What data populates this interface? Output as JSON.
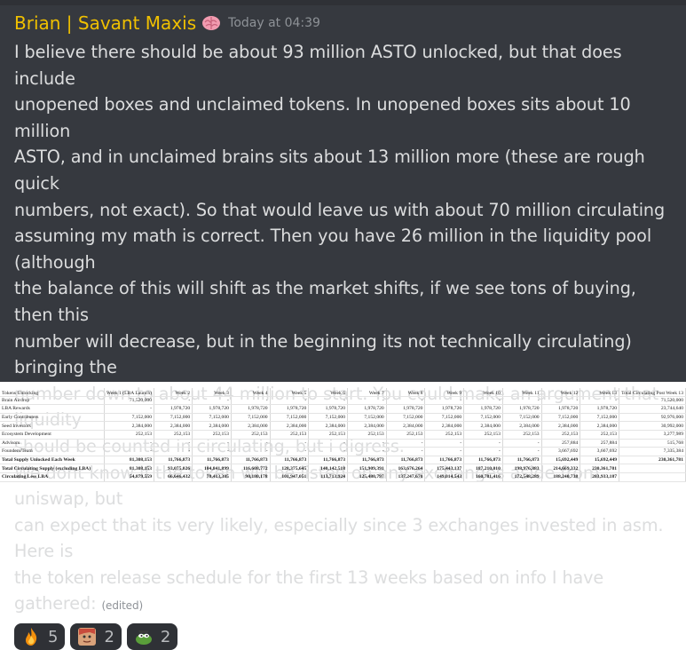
{
  "message": {
    "username": "Brian | Savant Maxis",
    "badge_icon": "brain-icon",
    "timestamp": "Today at 04:39",
    "lines": [
      "I believe there should be about 93 million ASTO unlocked, but that does include",
      "unopened boxes and unclaimed tokens. In unopened boxes sits about 10 million",
      "ASTO, and in unclaimed brains sits about 13 million more (these are rough quick",
      "numbers, not exact). So that would leave us with about 70 million circulating",
      "assuming my math is correct. Then you have 26 million in the liquidity pool (although",
      "the balance of this will shift as the market shifts, if we see tons of buying, then this",
      "number will decrease, but in the beginning its not technically circulating) bringing the",
      "number down to about 44 million to start. You could make an argument that liquidity",
      "should be counted in circulating, but i digress.",
      "We dont know if the token will be listed on any exchanges aside from uniswap, but",
      "can expect that its very likely, especially since 3 exchanges invested in asm. Here is",
      "the token release schedule for the first 13 weeks based on info I have gathered:"
    ],
    "edited_label": "(edited)"
  },
  "reactions": [
    {
      "icon": "fire-icon",
      "count": "5"
    },
    {
      "icon": "face-icon",
      "count": "2"
    },
    {
      "icon": "pepe-icon",
      "count": "2"
    }
  ],
  "spreadsheet": {
    "header": [
      "Tokens Unlocking",
      "Week 1 (LBA Launch)",
      "Week 2",
      "Week 3",
      "Week 4",
      "Week 5",
      "Week 6",
      "Week 7",
      "Week 8",
      "Week 9",
      "Week 10",
      "Week 11",
      "Week 12",
      "Week 13",
      "Total Circulating Post Week 13"
    ],
    "rows": [
      {
        "bold": false,
        "cells": [
          "Brain Airdrop",
          "71,520,000",
          "-",
          "-",
          "-",
          "-",
          "-",
          "-",
          "-",
          "-",
          "-",
          "-",
          "-",
          "-",
          "71,520,000"
        ]
      },
      {
        "bold": false,
        "cells": [
          "LBA Rewards",
          "-",
          "1,978,720",
          "1,978,720",
          "1,978,720",
          "1,978,720",
          "1,978,720",
          "1,978,720",
          "1,978,720",
          "1,978,720",
          "1,978,720",
          "1,978,720",
          "1,978,720",
          "1,978,720",
          "23,744,640"
        ]
      },
      {
        "bold": false,
        "cells": [
          "Early Contributers",
          "7,152,000",
          "7,152,000",
          "7,152,000",
          "7,152,000",
          "7,152,000",
          "7,152,000",
          "7,152,000",
          "7,152,000",
          "7,152,000",
          "7,152,000",
          "7,152,000",
          "7,152,000",
          "7,152,000",
          "92,976,000"
        ]
      },
      {
        "bold": false,
        "cells": [
          "Seed Investors",
          "2,384,000",
          "2,384,000",
          "2,384,000",
          "2,384,000",
          "2,384,000",
          "2,384,000",
          "2,384,000",
          "2,384,000",
          "2,384,000",
          "2,384,000",
          "2,384,000",
          "2,384,000",
          "2,384,000",
          "30,992,000"
        ]
      },
      {
        "bold": false,
        "cells": [
          "Ecosystem Development",
          "252,153",
          "252,153",
          "252,153",
          "252,153",
          "252,153",
          "252,153",
          "252,153",
          "252,153",
          "252,153",
          "252,153",
          "252,153",
          "252,153",
          "252,153",
          "3,277,989"
        ]
      },
      {
        "bold": false,
        "cells": [
          "Advisors",
          "-",
          "-",
          "-",
          "-",
          "-",
          "-",
          "-",
          "-",
          "-",
          "-",
          "-",
          "257,884",
          "257,884",
          "515,768"
        ]
      },
      {
        "bold": false,
        "cells": [
          "Founders/Team",
          "-",
          "-",
          "-",
          "-",
          "-",
          "-",
          "-",
          "-",
          "-",
          "-",
          "-",
          "3,667,692",
          "3,667,692",
          "7,335,384"
        ]
      },
      {
        "bold": true,
        "cells": [
          "Total Supply Unlocked Each Week",
          "81,308,153",
          "11,766,873",
          "11,766,873",
          "11,766,873",
          "11,766,873",
          "11,766,873",
          "11,766,873",
          "11,766,873",
          "11,766,873",
          "11,766,873",
          "11,766,873",
          "15,692,449",
          "15,692,449",
          "230,361,781"
        ]
      },
      {
        "bold": true,
        "cells": [
          "Total Circulating Supply (excluding LBA)",
          "81,308,153",
          "93,075,026",
          "104,841,899",
          "116,608,772",
          "128,375,645",
          "140,142,518",
          "151,909,391",
          "163,676,264",
          "175,443,137",
          "187,210,010",
          "198,976,883",
          "214,669,332",
          "230,361,781",
          ""
        ]
      },
      {
        "bold": true,
        "cells": [
          "Circulating Less LBA",
          "54,879,559",
          "66,646,432",
          "78,413,305",
          "90,180,178",
          "101,947,051",
          "113,713,924",
          "125,480,797",
          "137,247,670",
          "149,014,543",
          "160,781,416",
          "172,548,289",
          "188,240,738",
          "203,933,187",
          ""
        ]
      }
    ]
  }
}
